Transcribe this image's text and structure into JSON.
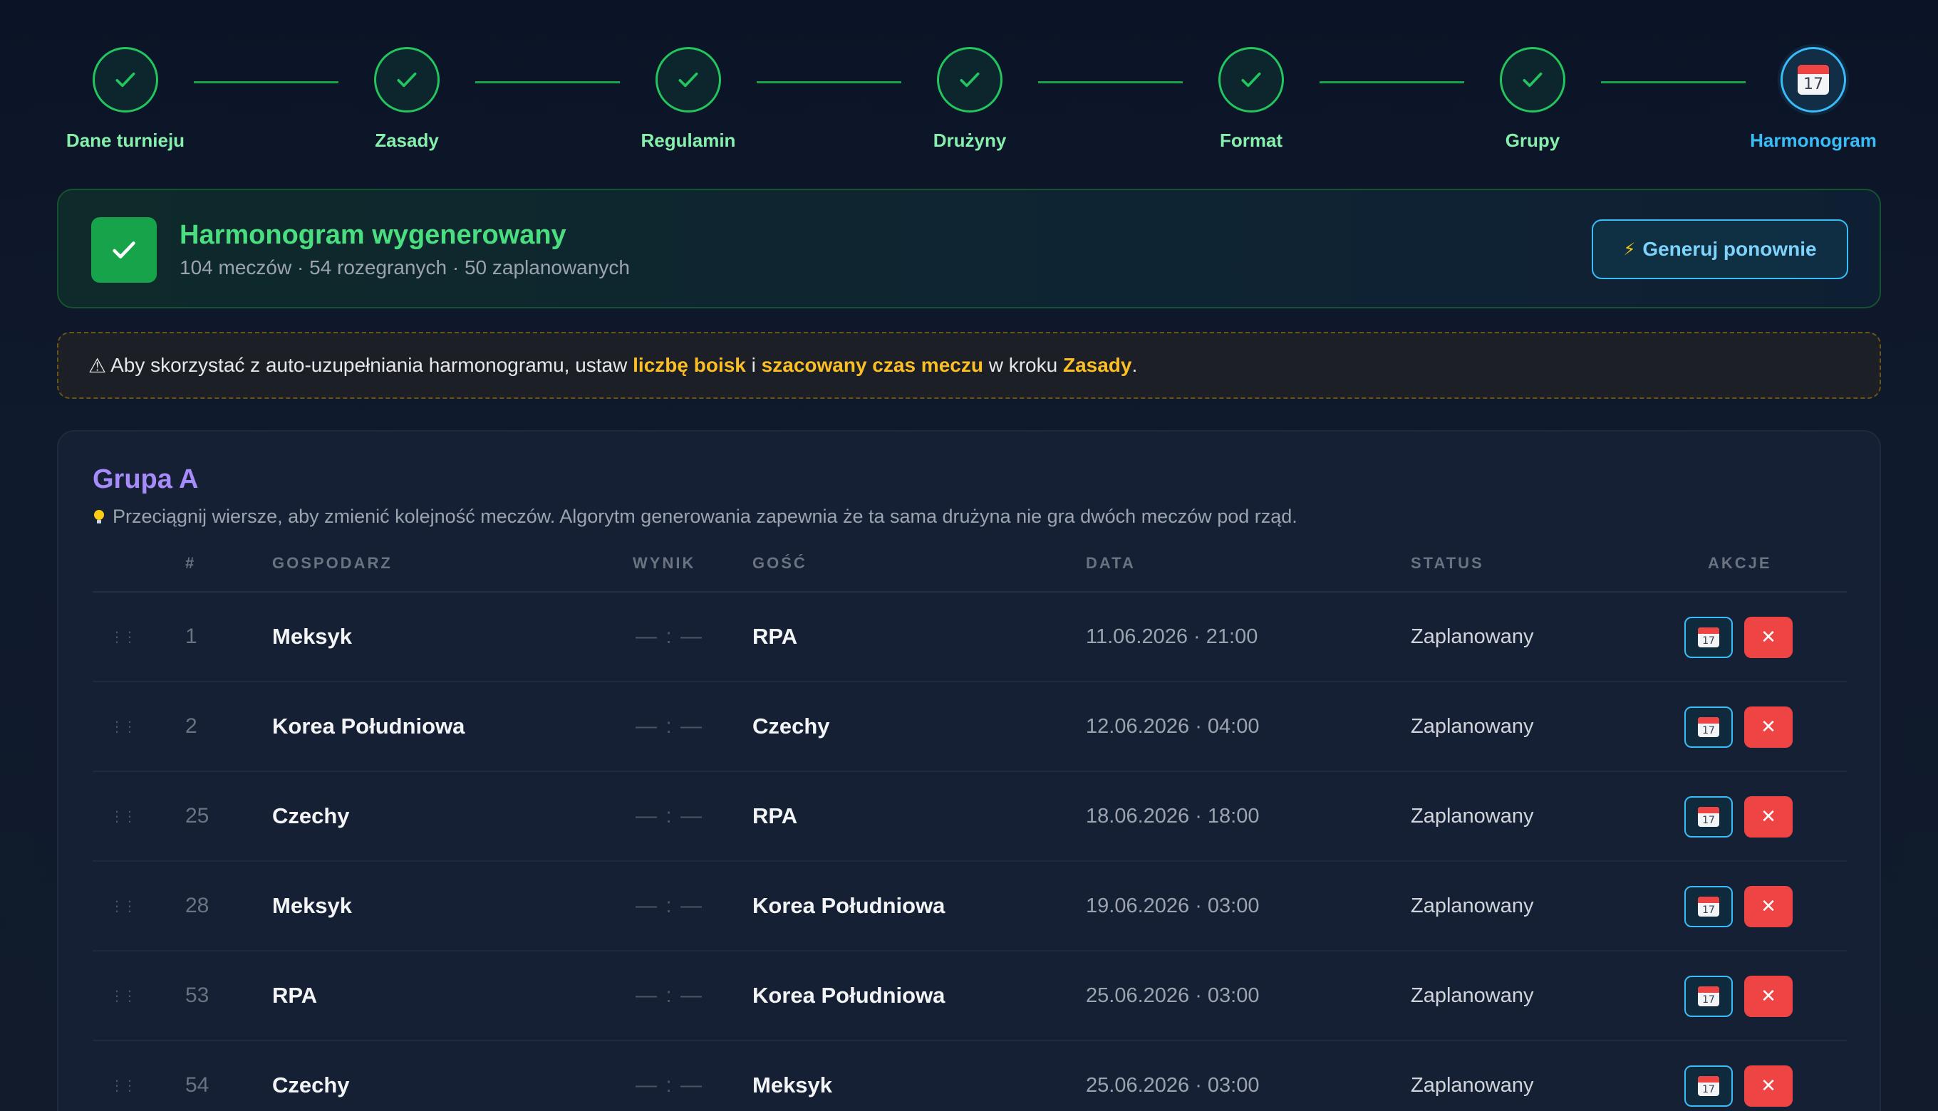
{
  "stepper": {
    "steps": [
      {
        "label": "Dane turnieju",
        "state": "done"
      },
      {
        "label": "Zasady",
        "state": "done"
      },
      {
        "label": "Regulamin",
        "state": "done"
      },
      {
        "label": "Drużyny",
        "state": "done"
      },
      {
        "label": "Format",
        "state": "done"
      },
      {
        "label": "Grupy",
        "state": "done"
      },
      {
        "label": "Harmonogram",
        "state": "active"
      }
    ],
    "calendar_day": "17"
  },
  "success": {
    "title": "Harmonogram wygenerowany",
    "subtitle": "104 meczów · 54 rozegranych · 50 zaplanowanych",
    "regen_icon": "⚡",
    "regen_label": "Generuj ponownie"
  },
  "warning": {
    "icon": "⚠",
    "text_1": "Aby skorzystać z auto-uzupełniania harmonogramu, ustaw",
    "hl_1": "liczbę boisk",
    "text_2": "i",
    "hl_2": "szacowany czas meczu",
    "text_3": "w kroku",
    "hl_3": "Zasady",
    "text_4": "."
  },
  "group": {
    "title": "Grupa A",
    "hint": "Przeciągnij wiersze, aby zmienić kolejność meczów. Algorytm generowania zapewnia że ta sama drużyna nie gra dwóch meczów pod rząd.",
    "columns": {
      "num": "#",
      "home": "GOSPODARZ",
      "score": "WYNIK",
      "away": "GOŚĆ",
      "date": "DATA",
      "status": "STATUS",
      "actions": "AKCJE"
    },
    "matches": [
      {
        "num": "1",
        "home": "Meksyk",
        "score": "— : —",
        "away": "RPA",
        "date": "11.06.2026 · 21:00",
        "status": "Zaplanowany"
      },
      {
        "num": "2",
        "home": "Korea Południowa",
        "score": "— : —",
        "away": "Czechy",
        "date": "12.06.2026 · 04:00",
        "status": "Zaplanowany"
      },
      {
        "num": "25",
        "home": "Czechy",
        "score": "— : —",
        "away": "RPA",
        "date": "18.06.2026 · 18:00",
        "status": "Zaplanowany"
      },
      {
        "num": "28",
        "home": "Meksyk",
        "score": "— : —",
        "away": "Korea Południowa",
        "date": "19.06.2026 · 03:00",
        "status": "Zaplanowany"
      },
      {
        "num": "53",
        "home": "RPA",
        "score": "— : —",
        "away": "Korea Południowa",
        "date": "25.06.2026 · 03:00",
        "status": "Zaplanowany"
      },
      {
        "num": "54",
        "home": "Czechy",
        "score": "— : —",
        "away": "Meksyk",
        "date": "25.06.2026 · 03:00",
        "status": "Zaplanowany"
      }
    ],
    "drag_glyph": "⋮⋮",
    "delete_glyph": "✕"
  },
  "colors": {
    "done": "#22c55e",
    "active": "#38bdf8",
    "group_title": "#a78bfa",
    "warning_highlight": "#fbbf24",
    "delete": "#ef4444"
  }
}
